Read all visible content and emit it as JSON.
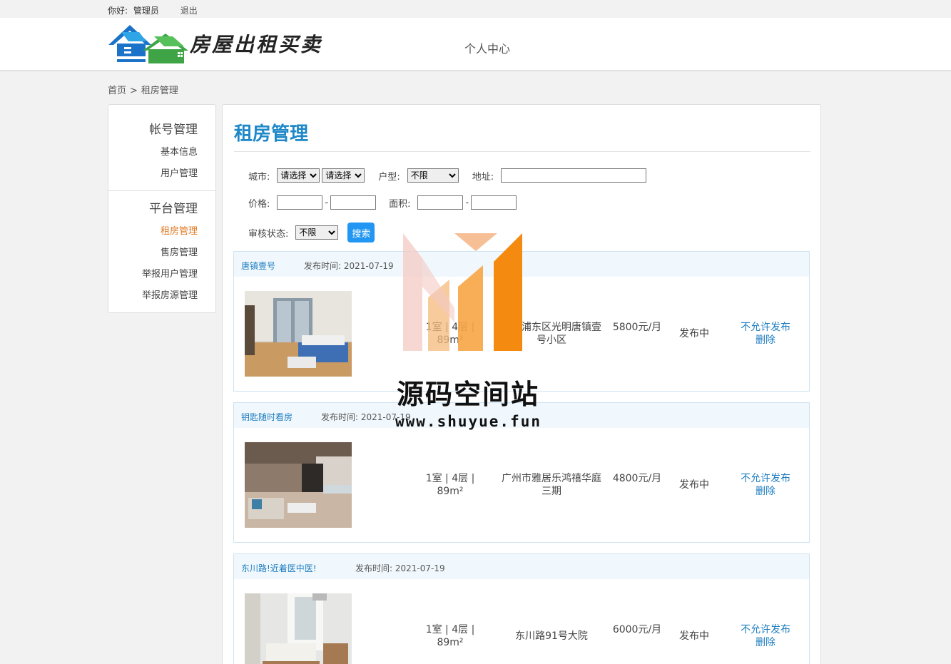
{
  "topbar": {
    "greeting": "你好:",
    "user": "管理员",
    "logout": "退出"
  },
  "header": {
    "site_name": "房屋出租买卖",
    "nav_item": "个人中心"
  },
  "breadcrumb": {
    "home": "首页",
    "sep": ">",
    "current": "租房管理"
  },
  "sidebar": {
    "groups": [
      {
        "title": "帐号管理",
        "items": [
          {
            "label": "基本信息"
          },
          {
            "label": "用户管理"
          }
        ]
      },
      {
        "title": "平台管理",
        "items": [
          {
            "label": "租房管理",
            "active": true
          },
          {
            "label": "售房管理"
          },
          {
            "label": "举报用户管理"
          },
          {
            "label": "举报房源管理"
          }
        ]
      }
    ]
  },
  "main": {
    "title": "租房管理",
    "filters": {
      "city_label": "城市:",
      "city_select1": "请选择",
      "city_select2": "请选择",
      "type_label": "户型:",
      "type_select": "不限",
      "addr_label": "地址:",
      "price_label": "价格:",
      "price_dash": "-",
      "area_label": "面积:",
      "area_dash": "-",
      "review_label": "审核状态:",
      "review_select": "不限",
      "search_btn": "搜索"
    },
    "listings": [
      {
        "title": "唐镇壹号",
        "date_label": "发布时间: 2021-07-19",
        "room": "1室 | 4层 | 89m²",
        "addr": "上海浦东区光明唐镇壹号小区",
        "price": "5800元/月",
        "status": "发布中",
        "action1": "不允许发布",
        "action2": "删除"
      },
      {
        "title": "钥匙随时看房",
        "date_label": "发布时间: 2021-07-19",
        "room": "1室 | 4层 | 89m²",
        "addr": "广州市雅居乐鸿禧华庭三期",
        "price": "4800元/月",
        "status": "发布中",
        "action1": "不允许发布",
        "action2": "删除"
      },
      {
        "title": "东川路!近着医中医!",
        "date_label": "发布时间: 2021-07-19",
        "room": "1室 | 4层 | 89m²",
        "addr": "东川路91号大院",
        "price": "6000元/月",
        "status": "发布中",
        "action1": "不允许发布",
        "action2": "删除"
      }
    ]
  },
  "watermark": {
    "line1": "源码空间站",
    "line2": "www.shuyue.fun"
  },
  "colors": {
    "accent": "#1e88c8",
    "active": "#e07a25",
    "button": "#2196f3"
  }
}
